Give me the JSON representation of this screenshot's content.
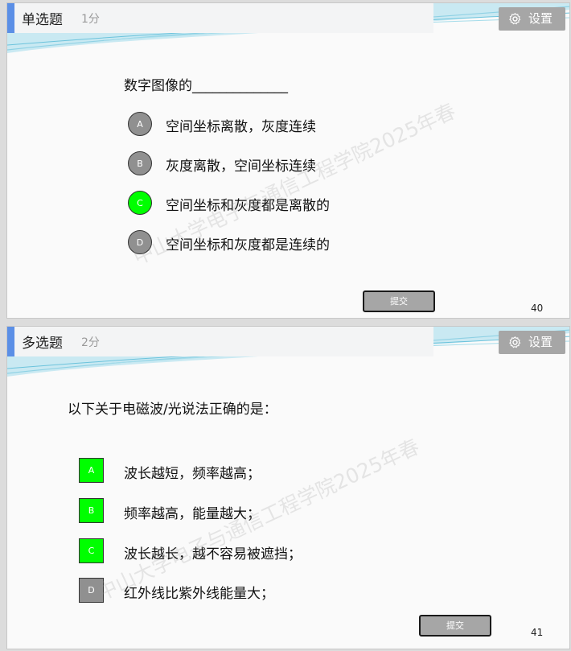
{
  "watermark": "中山大学电子与通信工程学院2025年春",
  "settings": {
    "label": "设置",
    "icon": "gear-icon"
  },
  "submit_label": "提交",
  "colors": {
    "selected": "#00ff00",
    "unselected": "#909090",
    "accent": "#5b8fe6",
    "button": "#a6a6a6"
  },
  "slides": [
    {
      "type": "单选题",
      "score": "1分",
      "question": "数字图像的______________",
      "options": [
        {
          "letter": "A",
          "text": "空间坐标离散，灰度连续",
          "selected": false
        },
        {
          "letter": "B",
          "text": "灰度离散，空间坐标连续",
          "selected": false
        },
        {
          "letter": "C",
          "text": "空间坐标和灰度都是离散的",
          "selected": true
        },
        {
          "letter": "D",
          "text": "空间坐标和灰度都是连续的",
          "selected": false
        }
      ],
      "page": "40"
    },
    {
      "type": "多选题",
      "score": "2分",
      "question": "以下关于电磁波/光说法正确的是：",
      "options": [
        {
          "letter": "A",
          "text": "波长越短，频率越高；",
          "selected": true
        },
        {
          "letter": "B",
          "text": "频率越高，能量越大；",
          "selected": true
        },
        {
          "letter": "C",
          "text": "波长越长，越不容易被遮挡；",
          "selected": true
        },
        {
          "letter": "D",
          "text": "红外线比紫外线能量大；",
          "selected": false
        }
      ],
      "page": "41"
    }
  ]
}
